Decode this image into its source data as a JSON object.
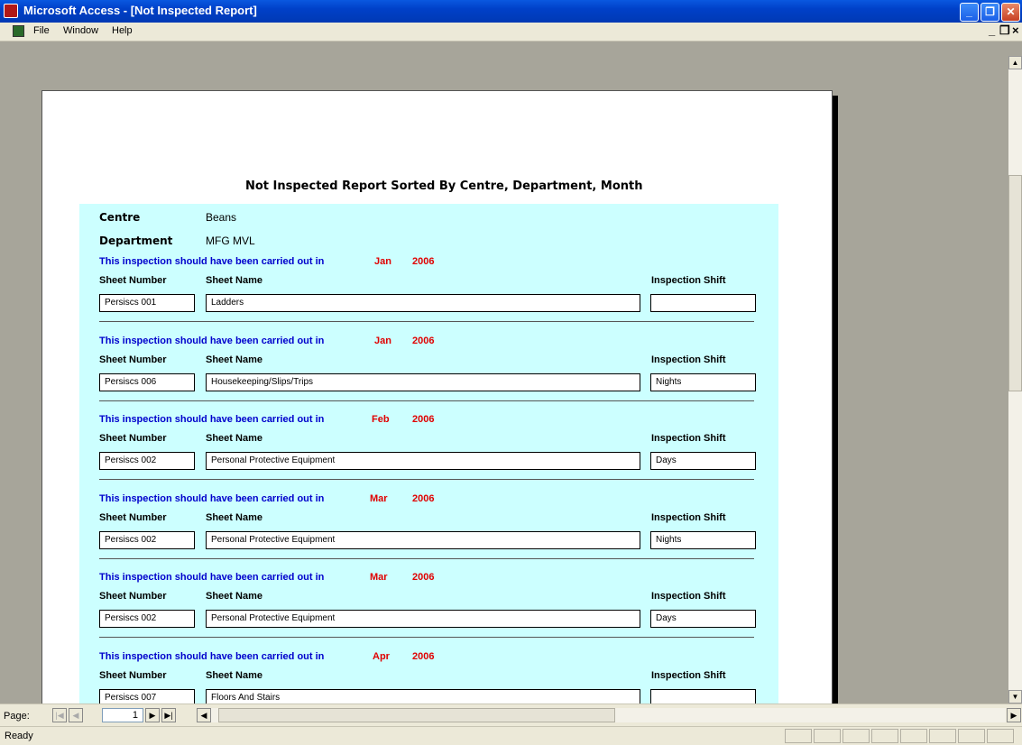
{
  "window": {
    "title": "Microsoft Access - [Not Inspected Report]"
  },
  "window_controls": {
    "minimize": "_",
    "restore": "❐",
    "close": "✕"
  },
  "menu": {
    "file": "File",
    "window": "Window",
    "help": "Help"
  },
  "mdi_controls": {
    "minimize": "_",
    "restore": "❐",
    "close": "×"
  },
  "report": {
    "title": "Not Inspected Report Sorted By Centre, Department, Month",
    "centre_label": "Centre",
    "centre_value": "Beans",
    "department_label": "Department",
    "department_value": "MFG MVL",
    "message": "This inspection should have been carried out in",
    "headers": {
      "sheet_number": "Sheet Number",
      "sheet_name": "Sheet Name",
      "inspection_shift": "Inspection Shift"
    },
    "groups": [
      {
        "month": "Jan",
        "year": "2006",
        "sheet_number": "Persiscs 001",
        "sheet_name": "Ladders",
        "shift": ""
      },
      {
        "month": "Jan",
        "year": "2006",
        "sheet_number": "Persiscs 006",
        "sheet_name": "Housekeeping/Slips/Trips",
        "shift": "Nights"
      },
      {
        "month": "Feb",
        "year": "2006",
        "sheet_number": "Persiscs 002",
        "sheet_name": "Personal Protective Equipment",
        "shift": "Days"
      },
      {
        "month": "Mar",
        "year": "2006",
        "sheet_number": "Persiscs 002",
        "sheet_name": "Personal Protective Equipment",
        "shift": "Nights"
      },
      {
        "month": "Mar",
        "year": "2006",
        "sheet_number": "Persiscs 002",
        "sheet_name": "Personal Protective Equipment",
        "shift": "Days"
      },
      {
        "month": "Apr",
        "year": "2006",
        "sheet_number": "Persiscs 007",
        "sheet_name": "Floors And Stairs",
        "shift": ""
      }
    ]
  },
  "navigation": {
    "page_label": "Page:",
    "current_page": "1"
  },
  "status": {
    "text": "Ready"
  }
}
